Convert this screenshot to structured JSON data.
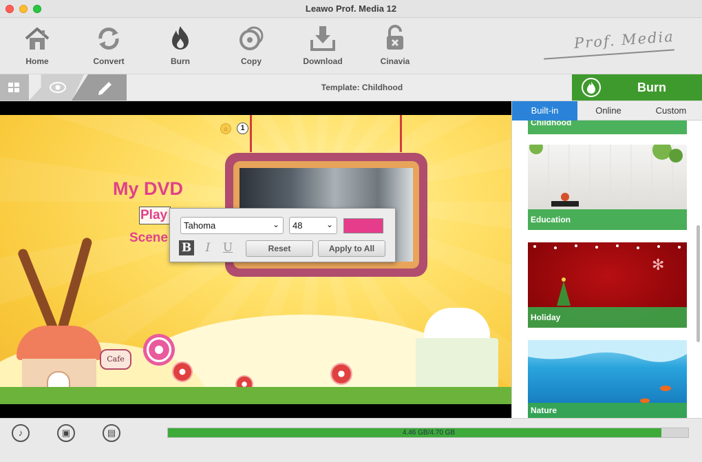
{
  "window": {
    "title": "Leawo Prof. Media 12"
  },
  "toolbar": {
    "items": [
      {
        "label": "Home",
        "icon": "home-icon"
      },
      {
        "label": "Convert",
        "icon": "convert-icon"
      },
      {
        "label": "Burn",
        "icon": "burn-icon"
      },
      {
        "label": "Copy",
        "icon": "copy-icon"
      },
      {
        "label": "Download",
        "icon": "download-icon"
      },
      {
        "label": "Cinavia",
        "icon": "cinavia-icon"
      }
    ],
    "brand": "Prof. Media"
  },
  "subbar": {
    "template_label": "Template: Childhood",
    "burn_label": "Burn"
  },
  "preview": {
    "page_number": "1",
    "menu_title": "My DVD",
    "play_label": "Play",
    "scene_label": "Scene",
    "cafe_sign": "Cafe"
  },
  "font_popup": {
    "font": "Tahoma",
    "size": "48",
    "color": "#e63c8c",
    "bold_label": "B",
    "italic_label": "I",
    "underline_label": "U",
    "reset_label": "Reset",
    "apply_label": "Apply to All"
  },
  "panel": {
    "tabs": [
      {
        "label": "Built-in",
        "active": true
      },
      {
        "label": "Online",
        "active": false
      },
      {
        "label": "Custom",
        "active": false
      }
    ],
    "templates": [
      {
        "name": "Childhood"
      },
      {
        "name": "Education"
      },
      {
        "name": "Holiday"
      },
      {
        "name": "Nature"
      }
    ]
  },
  "bottombar": {
    "icons": [
      "music-icon",
      "image-icon",
      "save-icon"
    ],
    "progress_text": "4.46 GB/4.70 GB",
    "progress_fraction": 0.949
  }
}
